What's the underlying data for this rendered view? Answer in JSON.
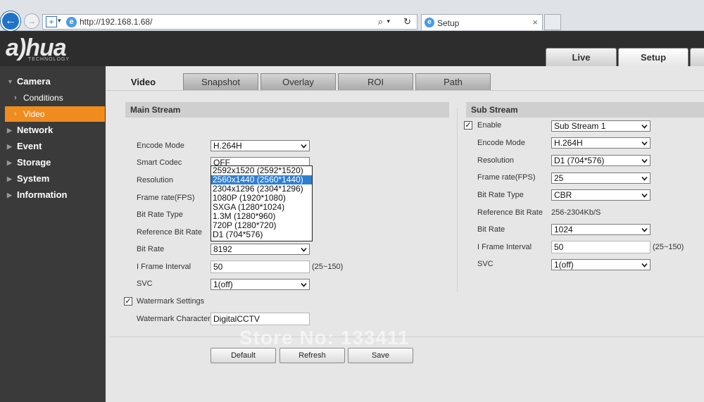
{
  "browser": {
    "url": "http://192.168.1.68/",
    "tab_title": "Setup",
    "close_glyph": "×"
  },
  "header": {
    "logo": "a)hua",
    "logo_sub": "TECHNOLOGY",
    "tabs": [
      {
        "label": "Live"
      },
      {
        "label": "Setup"
      }
    ]
  },
  "sidebar": {
    "items": [
      {
        "label": "Camera"
      },
      {
        "label": "Conditions"
      },
      {
        "label": "Video"
      },
      {
        "label": "Network"
      },
      {
        "label": "Event"
      },
      {
        "label": "Storage"
      },
      {
        "label": "System"
      },
      {
        "label": "Information"
      }
    ]
  },
  "tabs": [
    {
      "label": "Video"
    },
    {
      "label": "Snapshot"
    },
    {
      "label": "Overlay"
    },
    {
      "label": "ROI"
    },
    {
      "label": "Path"
    }
  ],
  "main_stream": {
    "title": "Main Stream",
    "encode_mode": {
      "label": "Encode Mode",
      "value": "H.264H"
    },
    "smart_codec": {
      "label": "Smart Codec",
      "value": "OFF"
    },
    "resolution": {
      "label": "Resolution",
      "options": [
        "2592x1520 (2592*1520)",
        "2560x1440 (2560*1440)",
        "2304x1296 (2304*1296)",
        "1080P (1920*1080)",
        "SXGA (1280*1024)",
        "1.3M (1280*960)",
        "720P (1280*720)",
        "D1 (704*576)"
      ],
      "highlighted": 1
    },
    "frame_rate": {
      "label": "Frame rate(FPS)"
    },
    "bit_rate_type": {
      "label": "Bit Rate Type"
    },
    "reference_bit_rate": {
      "label": "Reference Bit Rate"
    },
    "bit_rate": {
      "label": "Bit Rate",
      "value": "8192"
    },
    "i_frame_interval": {
      "label": "I Frame Interval",
      "value": "50",
      "hint": "(25~150)"
    },
    "svc": {
      "label": "SVC",
      "value": "1(off)"
    },
    "watermark_settings": {
      "label": "Watermark Settings",
      "checked": true
    },
    "watermark_character": {
      "label": "Watermark Character",
      "value": "DigitalCCTV"
    }
  },
  "sub_stream": {
    "title": "Sub Stream",
    "enable": {
      "label": "Enable",
      "checked": true,
      "value": "Sub Stream 1"
    },
    "encode_mode": {
      "label": "Encode Mode",
      "value": "H.264H"
    },
    "resolution": {
      "label": "Resolution",
      "value": "D1 (704*576)"
    },
    "frame_rate": {
      "label": "Frame rate(FPS)",
      "value": "25"
    },
    "bit_rate_type": {
      "label": "Bit Rate Type",
      "value": "CBR"
    },
    "reference_bit_rate": {
      "label": "Reference Bit Rate",
      "value": "256-2304Kb/S"
    },
    "bit_rate": {
      "label": "Bit Rate",
      "value": "1024"
    },
    "i_frame_interval": {
      "label": "I Frame Interval",
      "value": "50",
      "hint": "(25~150)"
    },
    "svc": {
      "label": "SVC",
      "value": "1(off)"
    }
  },
  "buttons": {
    "default": "Default",
    "refresh": "Refresh",
    "save": "Save"
  },
  "watermark_text": "Store No: 133411",
  "glyphs": {
    "check": "✓",
    "back": "←",
    "forward": "→",
    "search": "⌕",
    "refresh": "↻",
    "plus": "+",
    "ie": "e",
    "drop": "▾",
    "side_collapsed": "▶",
    "side_expanded": "▼",
    "side_sub": "›"
  }
}
